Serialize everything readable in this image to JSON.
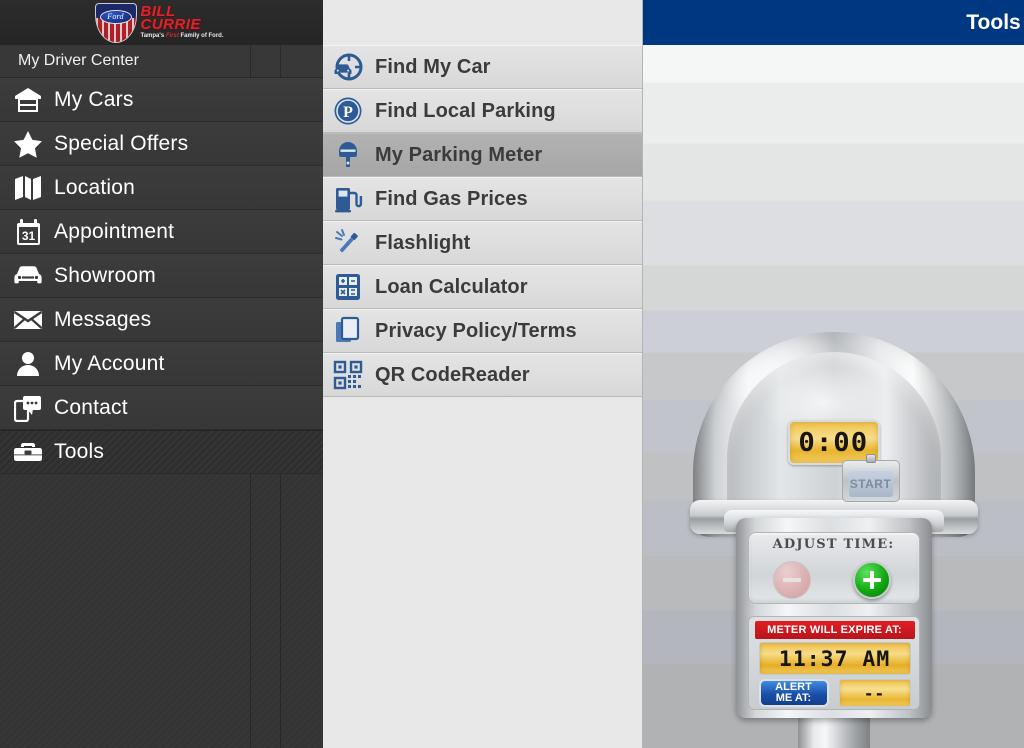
{
  "brand": {
    "logo_ford_text": "Ford",
    "logo_line1": "BILL",
    "logo_line2": "CURRIE",
    "tagline_pre": "Tampa's ",
    "tagline_em": "First",
    "tagline_post": " Family of Ford."
  },
  "sidebar": {
    "section_title": "My Driver Center",
    "items": [
      {
        "label": "My Cars",
        "icon": "garage-icon",
        "active": false
      },
      {
        "label": "Special Offers",
        "icon": "star-icon",
        "active": false
      },
      {
        "label": "Location",
        "icon": "map-icon",
        "active": false
      },
      {
        "label": "Appointment",
        "icon": "calendar-icon",
        "active": false,
        "calendar_day": "31"
      },
      {
        "label": "Showroom",
        "icon": "car-icon",
        "active": false
      },
      {
        "label": "Messages",
        "icon": "envelope-icon",
        "active": false
      },
      {
        "label": "My Account",
        "icon": "person-icon",
        "active": false
      },
      {
        "label": "Contact",
        "icon": "chat-phone-icon",
        "active": false
      },
      {
        "label": "Tools",
        "icon": "toolbox-icon",
        "active": true
      }
    ]
  },
  "header": {
    "title": "Tools"
  },
  "tools": {
    "items": [
      {
        "label": "Find My Car",
        "icon": "car-locator-icon",
        "selected": false
      },
      {
        "label": "Find Local Parking",
        "icon": "parking-p-icon",
        "selected": false
      },
      {
        "label": "My Parking Meter",
        "icon": "parking-meter-icon",
        "selected": true
      },
      {
        "label": "Find Gas Prices",
        "icon": "gas-pump-icon",
        "selected": false
      },
      {
        "label": "Flashlight",
        "icon": "flashlight-icon",
        "selected": false
      },
      {
        "label": "Loan Calculator",
        "icon": "calculator-icon",
        "selected": false
      },
      {
        "label": "Privacy Policy/Terms",
        "icon": "documents-icon",
        "selected": false
      },
      {
        "label": "QR CodeReader",
        "icon": "qr-code-icon",
        "selected": false
      }
    ]
  },
  "meter": {
    "timer_display": "0:00",
    "start_button": "START",
    "adjust_label": "ADJUST TIME:",
    "decrease_button": "−",
    "increase_button": "+",
    "expire_banner": "METER WILL EXPIRE AT:",
    "expire_time": "11:37 AM",
    "alert_button_line1": "ALERT",
    "alert_button_line2": "ME AT:",
    "alert_time": "--"
  },
  "colors": {
    "header_blue": "#003781",
    "sidebar_bg": "#343434",
    "tool_selected": "#a6a6a6",
    "expire_red": "#d01a20",
    "alert_blue": "#1a4fa8",
    "lcd_amber": "#f0c34a",
    "plus_green": "#11aa11"
  }
}
